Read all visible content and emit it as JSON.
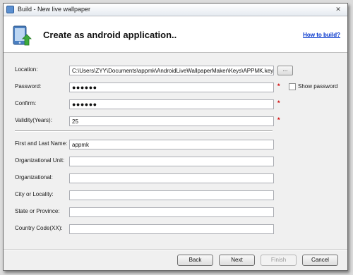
{
  "window": {
    "title": "Build - New live wallpaper",
    "close_symbol": "✕"
  },
  "header": {
    "title": "Create as android application..",
    "help_link": "How to build?"
  },
  "form": {
    "location": {
      "label": "Location:",
      "value": "C:\\Users\\ZYY\\Documents\\appmk\\AndroidLiveWallpaperMaker\\Keys\\APPMK.key",
      "browse_label": "..."
    },
    "password": {
      "label": "Password:",
      "value": "●●●●●●",
      "required_mark": "*",
      "show_password_label": "Show password",
      "show_password_checked": false
    },
    "confirm": {
      "label": "Confirm:",
      "value": "●●●●●●",
      "required_mark": "*"
    },
    "validity": {
      "label": "Validity(Years):",
      "value": "25",
      "required_mark": "*"
    },
    "first_last_name": {
      "label": "First and Last Name:",
      "value": "appmk"
    },
    "organizational_unit": {
      "label": "Organizational Unit:",
      "value": ""
    },
    "organizational": {
      "label": "Organizational:",
      "value": ""
    },
    "city": {
      "label": "City or Locality:",
      "value": ""
    },
    "state": {
      "label": "State or Province:",
      "value": ""
    },
    "country_code": {
      "label": "Country Code(XX):",
      "value": ""
    }
  },
  "buttons": {
    "back": "Back",
    "next": "Next",
    "finish": "Finish",
    "cancel": "Cancel"
  },
  "colors": {
    "link": "#0033cc",
    "required": "#d10000",
    "app_icon_green": "#3daa3d",
    "app_icon_body": "#4a7fc1"
  }
}
